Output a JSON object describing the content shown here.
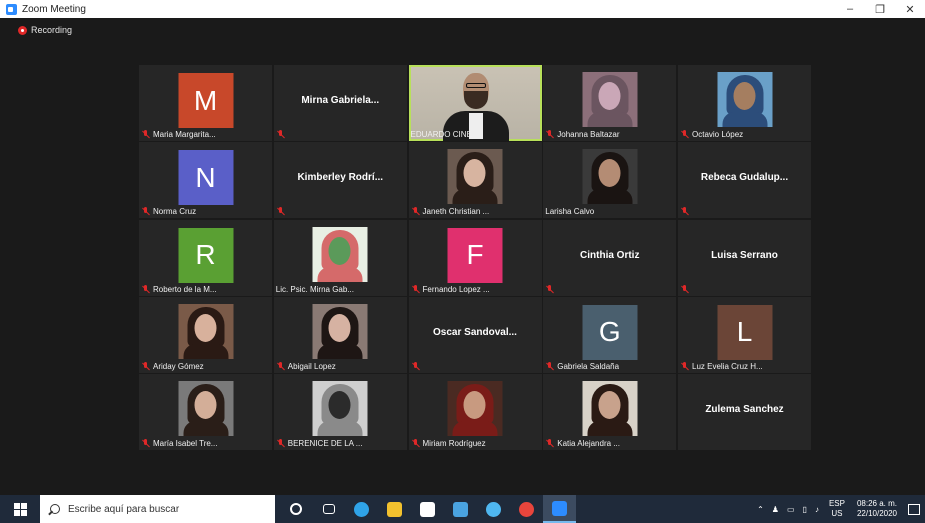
{
  "window": {
    "title": "Zoom Meeting",
    "minimize": "–",
    "maximize": "❐",
    "close": "✕"
  },
  "recording": {
    "label": "Recording"
  },
  "colors": {
    "active_speaker_border": "#b8e05a",
    "muted_mic": "#e02828",
    "tile_bg": "#262626"
  },
  "participants": [
    {
      "name": "Maria Margarita...",
      "type": "avatar",
      "letter": "M",
      "color": "#c8482a",
      "muted": true
    },
    {
      "name": "",
      "display": "Mirna  Gabriela...",
      "type": "name",
      "muted": true
    },
    {
      "name": "EDUARDO CINE",
      "type": "video",
      "active": true,
      "muted": false
    },
    {
      "name": "Johanna Baltazar",
      "type": "photo",
      "muted": true,
      "photo_colors": [
        "#8c6f7a",
        "#caa7b7",
        "#6b5560"
      ]
    },
    {
      "name": "Octavio López",
      "type": "photo",
      "muted": true,
      "photo_colors": [
        "#6aa0c8",
        "#a57e60",
        "#2c4d7a"
      ]
    },
    {
      "name": "Norma Cruz",
      "type": "avatar",
      "letter": "N",
      "color": "#5a5fc8",
      "muted": true
    },
    {
      "name": "",
      "display": "Kimberley  Rodrí...",
      "type": "name",
      "muted": true
    },
    {
      "name": "Janeth Christian ...",
      "type": "photo",
      "muted": true,
      "photo_colors": [
        "#6b5a50",
        "#d7b4a0",
        "#2a1e18"
      ]
    },
    {
      "name": "Larisha Calvo",
      "type": "photo",
      "muted": false,
      "photo_colors": [
        "#3a3a3a",
        "#b48c74",
        "#1a1412"
      ]
    },
    {
      "name": "",
      "display": "Rebeca  Gudalup...",
      "type": "name",
      "muted": true
    },
    {
      "name": "Roberto de la M...",
      "type": "avatar",
      "letter": "R",
      "color": "#5aa033",
      "muted": true
    },
    {
      "name": "Lic. Psic. Mirna Gab...",
      "type": "photo",
      "muted": false,
      "photo_colors": [
        "#e8efe4",
        "#5b9a5a",
        "#d56a6a"
      ]
    },
    {
      "name": "Fernando Lopez ...",
      "type": "avatar",
      "letter": "F",
      "color": "#e0306e",
      "muted": true
    },
    {
      "name": "",
      "display": "Cinthia Ortiz",
      "type": "name",
      "muted": true
    },
    {
      "name": "",
      "display": "Luisa Serrano",
      "type": "name",
      "muted": true
    },
    {
      "name": "Ariday Gómez",
      "type": "photo",
      "muted": true,
      "photo_colors": [
        "#7a5a48",
        "#d8b19c",
        "#2a1a14"
      ]
    },
    {
      "name": "Abigail Lopez",
      "type": "photo",
      "muted": true,
      "photo_colors": [
        "#8a7a74",
        "#d6b2a2",
        "#1e1614"
      ]
    },
    {
      "name": "",
      "display": "Oscar  Sandoval...",
      "type": "name",
      "muted": true
    },
    {
      "name": "Gabriela Saldaña",
      "type": "avatar",
      "letter": "G",
      "color": "#4a5f6e",
      "muted": true
    },
    {
      "name": "Luz Evelia Cruz H...",
      "type": "avatar",
      "letter": "L",
      "color": "#6b4537",
      "muted": true
    },
    {
      "name": "María Isabel Tre...",
      "type": "photo",
      "muted": true,
      "photo_colors": [
        "#7a7a7a",
        "#d3ae98",
        "#2a1e18"
      ]
    },
    {
      "name": "BERENICE DE LA ...",
      "type": "photo",
      "muted": true,
      "photo_colors": [
        "#cfcfcf",
        "#2b2b2b",
        "#8a8a8a"
      ]
    },
    {
      "name": "Miriam Rodríguez",
      "type": "photo",
      "muted": true,
      "photo_colors": [
        "#4a2a22",
        "#c89a80",
        "#7a1c18"
      ]
    },
    {
      "name": "Katia Alejandra ...",
      "type": "photo",
      "muted": true,
      "photo_colors": [
        "#d8d2c8",
        "#c8a28c",
        "#2a1a14"
      ]
    },
    {
      "name": "",
      "display": "Zulema Sanchez",
      "type": "name",
      "muted": false
    }
  ],
  "taskbar": {
    "search_placeholder": "Escribe aquí para buscar",
    "icons": [
      {
        "name": "cortana-icon",
        "color": "#ffffff"
      },
      {
        "name": "task-view-icon",
        "color": "#ffffff"
      },
      {
        "name": "edge-icon",
        "color": "#2fa3e8"
      },
      {
        "name": "file-explorer-icon",
        "color": "#f2c12e"
      },
      {
        "name": "store-icon",
        "color": "#ffffff"
      },
      {
        "name": "mail-icon",
        "color": "#4aa3e0"
      },
      {
        "name": "ie-icon",
        "color": "#4fb7f0"
      },
      {
        "name": "chrome-icon",
        "color": "#e8453c"
      },
      {
        "name": "zoom-icon",
        "color": "#2d8cff"
      }
    ],
    "lang_top": "ESP",
    "lang_bottom": "US",
    "time": "08:26 a. m.",
    "date": "22/10/2020"
  }
}
